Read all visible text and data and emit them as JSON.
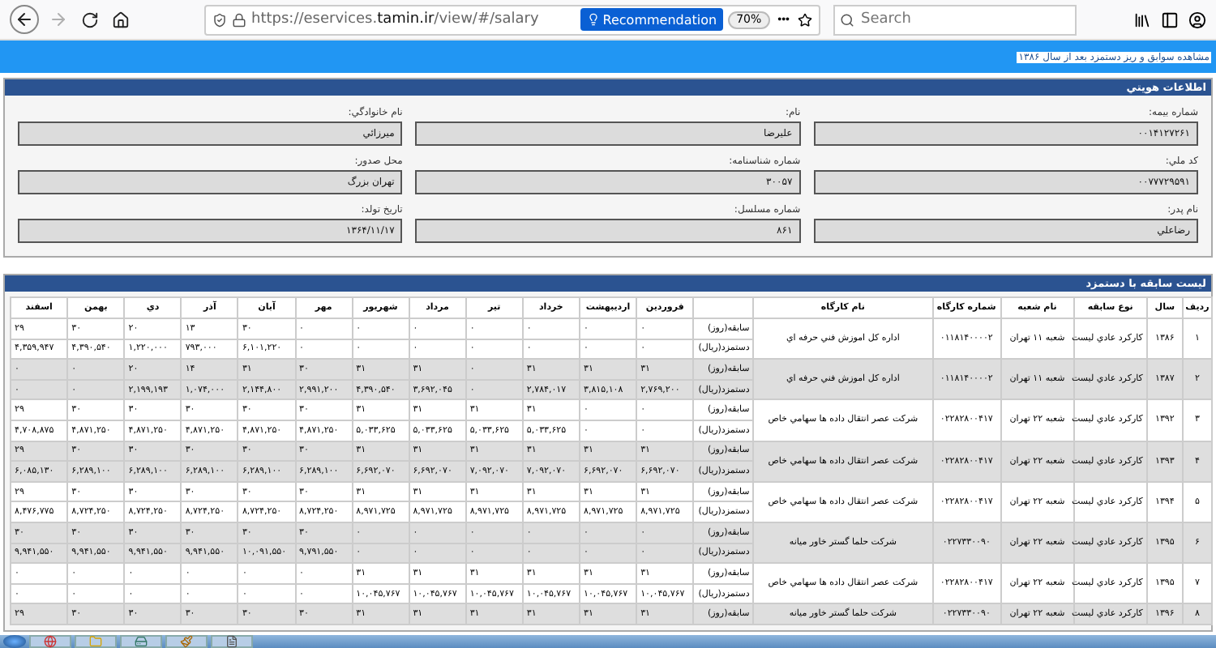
{
  "browser": {
    "forward_disabled": true,
    "url": "https://eservices.**tamin.ir**/view/#/salary",
    "recommendation": "Recommendation",
    "zoom": "70%",
    "more": "•••",
    "search": {
      "placeholder": "Search"
    }
  },
  "banner": {
    "text": "مشاهده سوابق و ريز دستمزد بعد از سال ۱۳۸۶"
  },
  "identity": {
    "title": "اطلاعات هويتي",
    "fields": [
      {
        "label": "شماره بيمه:",
        "value": "۰۰۱۴۱۲۷۲۶۱"
      },
      {
        "label": "نام:",
        "value": "عليرضا"
      },
      {
        "label": "نام خانوادگي:",
        "value": "ميرزائي"
      },
      {
        "label": "کد ملي:",
        "value": "۰۰۷۷۷۲۹۵۹۱"
      },
      {
        "label": "شماره شناسنامه:",
        "value": "۳۰۰۵۷"
      },
      {
        "label": "محل صدور:",
        "value": "تهران بزرگ"
      },
      {
        "label": "نام پدر:",
        "value": "رضاعلي"
      },
      {
        "label": "شماره مسلسل:",
        "value": "۸۶۱"
      },
      {
        "label": "تاريخ تولد:",
        "value": "۱۳۶۴/۱۱/۱۷"
      }
    ]
  },
  "history": {
    "title": "ليست سابقه با دستمزد",
    "columns": [
      "رديف",
      "سال",
      "نوع سابقه",
      "نام شعبه",
      "شماره کارگاه",
      "نام کارگاه",
      "",
      "فروردين",
      "ارديبهشت",
      "خرداد",
      "تير",
      "مرداد",
      "شهريور",
      "مهر",
      "آبان",
      "آذر",
      "دي",
      "بهمن",
      "اسفند"
    ],
    "rows": [
      {
        "index": "۱",
        "year": "۱۳۸۶",
        "type": "کارکرد عادي ليست",
        "branch": "شعبه ۱۱ تهران",
        "workshop_no": "۰۱۱۸۱۴۰۰۰۰۲",
        "workshop": "اداره کل اموزش فني حرفه اي",
        "lines": [
          {
            "label": "سابقه(روز)",
            "values": [
              "۰",
              "۰",
              "۰",
              "۰",
              "۰",
              "۰",
              "۰",
              "۳۰",
              "۱۳",
              "۲۰",
              "۳۰",
              "۲۹"
            ]
          },
          {
            "label": "دستمزد(ريال)",
            "values": [
              "۰",
              "۰",
              "۰",
              "۰",
              "۰",
              "۰",
              "۰",
              "۶,۱۰۱,۲۲۰",
              "۷۹۳,۰۰۰",
              "۱,۲۲۰,۰۰۰",
              "۴,۳۹۰,۵۴۰",
              "۴,۳۵۹,۹۴۷"
            ]
          }
        ]
      },
      {
        "index": "۲",
        "year": "۱۳۸۷",
        "type": "کارکرد عادي ليست",
        "branch": "شعبه ۱۱ تهران",
        "workshop_no": "۰۱۱۸۱۴۰۰۰۰۲",
        "workshop": "اداره کل اموزش فني حرفه اي",
        "lines": [
          {
            "label": "سابقه(روز)",
            "values": [
              "۳۱",
              "۳۱",
              "۳۱",
              "۰",
              "۳۱",
              "۳۱",
              "۳۰",
              "۳۱",
              "۱۴",
              "۲۰",
              "۰",
              "۰"
            ]
          },
          {
            "label": "دستمزد(ريال)",
            "values": [
              "۲,۷۶۹,۲۰۰",
              "۳,۸۱۵,۱۰۸",
              "۲,۷۸۴,۰۱۷",
              "۰",
              "۳,۶۹۲,۰۴۵",
              "۴,۳۹۰,۵۴۰",
              "۲,۹۹۱,۲۰۰",
              "۲,۱۴۴,۸۰۰",
              "۱,۰۷۴,۰۰۰",
              "۲,۱۹۹,۱۹۳",
              "۰",
              "۰"
            ]
          }
        ]
      },
      {
        "index": "۳",
        "year": "۱۳۹۲",
        "type": "کارکرد عادي ليست",
        "branch": "شعبه ۲۲ تهران",
        "workshop_no": "۰۲۲۸۲۸۰۰۴۱۷",
        "workshop": "شرکت عصر انتقال داده ها سهامي خاص",
        "lines": [
          {
            "label": "سابقه(روز)",
            "values": [
              "۰",
              "۰",
              "۳۱",
              "۳۱",
              "۳۱",
              "۳۱",
              "۳۰",
              "۳۰",
              "۳۰",
              "۳۰",
              "۳۰",
              "۲۹"
            ]
          },
          {
            "label": "دستمزد(ريال)",
            "values": [
              "۰",
              "۰",
              "۵,۰۳۳,۶۲۵",
              "۵,۰۳۳,۶۲۵",
              "۵,۰۳۳,۶۲۵",
              "۵,۰۳۳,۶۲۵",
              "۴,۸۷۱,۲۵۰",
              "۴,۸۷۱,۲۵۰",
              "۴,۸۷۱,۲۵۰",
              "۴,۸۷۱,۲۵۰",
              "۴,۸۷۱,۲۵۰",
              "۴,۷۰۸,۸۷۵"
            ]
          }
        ]
      },
      {
        "index": "۴",
        "year": "۱۳۹۳",
        "type": "کارکرد عادي ليست",
        "branch": "شعبه ۲۲ تهران",
        "workshop_no": "۰۲۲۸۲۸۰۰۴۱۷",
        "workshop": "شرکت عصر انتقال داده ها سهامي خاص",
        "lines": [
          {
            "label": "سابقه(روز)",
            "values": [
              "۳۱",
              "۳۱",
              "۳۱",
              "۳۱",
              "۳۱",
              "۳۱",
              "۳۰",
              "۳۰",
              "۳۰",
              "۳۰",
              "۳۰",
              "۲۹"
            ]
          },
          {
            "label": "دستمزد(ريال)",
            "values": [
              "۶,۶۹۲,۰۷۰",
              "۶,۶۹۲,۰۷۰",
              "۷,۰۹۲,۰۷۰",
              "۷,۰۹۲,۰۷۰",
              "۶,۶۹۲,۰۷۰",
              "۶,۶۹۲,۰۷۰",
              "۶,۲۸۹,۱۰۰",
              "۶,۲۸۹,۱۰۰",
              "۶,۲۸۹,۱۰۰",
              "۶,۲۸۹,۱۰۰",
              "۶,۲۸۹,۱۰۰",
              "۶,۰۸۵,۱۳۰"
            ]
          }
        ]
      },
      {
        "index": "۵",
        "year": "۱۳۹۴",
        "type": "کارکرد عادي ليست",
        "branch": "شعبه ۲۲ تهران",
        "workshop_no": "۰۲۲۸۲۸۰۰۴۱۷",
        "workshop": "شرکت عصر انتقال داده ها سهامي خاص",
        "lines": [
          {
            "label": "سابقه(روز)",
            "values": [
              "۳۱",
              "۳۱",
              "۳۱",
              "۳۱",
              "۳۱",
              "۳۱",
              "۳۰",
              "۳۰",
              "۳۰",
              "۳۰",
              "۳۰",
              "۲۹"
            ]
          },
          {
            "label": "دستمزد(ريال)",
            "values": [
              "۸,۹۷۱,۷۲۵",
              "۸,۹۷۱,۷۲۵",
              "۸,۹۷۱,۷۲۵",
              "۸,۹۷۱,۷۲۵",
              "۸,۹۷۱,۷۲۵",
              "۸,۹۷۱,۷۲۵",
              "۸,۷۲۴,۲۵۰",
              "۸,۷۲۴,۲۵۰",
              "۸,۷۲۴,۲۵۰",
              "۸,۷۲۴,۲۵۰",
              "۸,۷۲۴,۲۵۰",
              "۸,۴۷۶,۷۷۵"
            ]
          }
        ]
      },
      {
        "index": "۶",
        "year": "۱۳۹۵",
        "type": "کارکرد عادي ليست",
        "branch": "شعبه ۲۲ تهران",
        "workshop_no": "۰۲۲۷۳۳۰۰۹۰",
        "workshop": "شرکت حلما گستر خاور ميانه",
        "lines": [
          {
            "label": "سابقه(روز)",
            "values": [
              "۰",
              "۰",
              "۰",
              "۰",
              "۰",
              "۰",
              "۳۰",
              "۳۰",
              "۳۰",
              "۳۰",
              "۳۰",
              "۳۰"
            ]
          },
          {
            "label": "دستمزد(ريال)",
            "values": [
              "۰",
              "۰",
              "۰",
              "۰",
              "۰",
              "۰",
              "۹,۷۹۱,۵۵۰",
              "۱۰,۰۹۱,۵۵۰",
              "۹,۹۴۱,۵۵۰",
              "۹,۹۴۱,۵۵۰",
              "۹,۹۴۱,۵۵۰",
              "۹,۹۴۱,۵۵۰"
            ]
          }
        ]
      },
      {
        "index": "۷",
        "year": "۱۳۹۵",
        "type": "کارکرد عادي ليست",
        "branch": "شعبه ۲۲ تهران",
        "workshop_no": "۰۲۲۸۲۸۰۰۴۱۷",
        "workshop": "شرکت عصر انتقال داده ها سهامي خاص",
        "lines": [
          {
            "label": "سابقه(روز)",
            "values": [
              "۳۱",
              "۳۱",
              "۳۱",
              "۳۱",
              "۳۱",
              "۳۱",
              "۰",
              "۰",
              "۰",
              "۰",
              "۰",
              "۰"
            ]
          },
          {
            "label": "دستمزد(ريال)",
            "values": [
              "۱۰,۰۴۵,۷۶۷",
              "۱۰,۰۴۵,۷۶۷",
              "۱۰,۰۴۵,۷۶۷",
              "۱۰,۰۴۵,۷۶۷",
              "۱۰,۰۴۵,۷۶۷",
              "۱۰,۰۴۵,۷۶۷",
              "۰",
              "۰",
              "۰",
              "۰",
              "۰",
              "۰"
            ]
          }
        ]
      },
      {
        "index": "۸",
        "year": "۱۳۹۶",
        "type": "کارکرد عادي ليست",
        "branch": "شعبه ۲۲ تهران",
        "workshop_no": "۰۲۲۷۳۳۰۰۹۰",
        "workshop": "شرکت حلما گستر خاور ميانه",
        "lines": [
          {
            "label": "سابقه(روز)",
            "values": [
              "۳۱",
              "۳۱",
              "۳۱",
              "۳۱",
              "۳۱",
              "۳۱",
              "۳۰",
              "۳۰",
              "۳۰",
              "۳۰",
              "۳۰",
              "۲۹"
            ]
          }
        ]
      }
    ]
  },
  "taskbar": {
    "apps": [
      {
        "kind": "browser"
      },
      {
        "kind": "folder"
      },
      {
        "kind": "explorer"
      },
      {
        "kind": "paint"
      },
      {
        "kind": "document"
      }
    ]
  }
}
